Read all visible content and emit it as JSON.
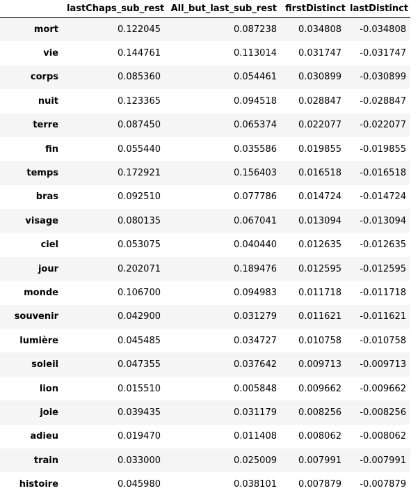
{
  "table": {
    "columns": [
      "",
      "lastChaps_sub_rest",
      "All_but_last_sub_rest",
      "firstDistinct",
      "lastDistinct"
    ],
    "rows": [
      {
        "index": "mort",
        "values": [
          "0.122045",
          "0.087238",
          "0.034808",
          "-0.034808"
        ]
      },
      {
        "index": "vie",
        "values": [
          "0.144761",
          "0.113014",
          "0.031747",
          "-0.031747"
        ]
      },
      {
        "index": "corps",
        "values": [
          "0.085360",
          "0.054461",
          "0.030899",
          "-0.030899"
        ]
      },
      {
        "index": "nuit",
        "values": [
          "0.123365",
          "0.094518",
          "0.028847",
          "-0.028847"
        ]
      },
      {
        "index": "terre",
        "values": [
          "0.087450",
          "0.065374",
          "0.022077",
          "-0.022077"
        ]
      },
      {
        "index": "fin",
        "values": [
          "0.055440",
          "0.035586",
          "0.019855",
          "-0.019855"
        ]
      },
      {
        "index": "temps",
        "values": [
          "0.172921",
          "0.156403",
          "0.016518",
          "-0.016518"
        ]
      },
      {
        "index": "bras",
        "values": [
          "0.092510",
          "0.077786",
          "0.014724",
          "-0.014724"
        ]
      },
      {
        "index": "visage",
        "values": [
          "0.080135",
          "0.067041",
          "0.013094",
          "-0.013094"
        ]
      },
      {
        "index": "ciel",
        "values": [
          "0.053075",
          "0.040440",
          "0.012635",
          "-0.012635"
        ]
      },
      {
        "index": "jour",
        "values": [
          "0.202071",
          "0.189476",
          "0.012595",
          "-0.012595"
        ]
      },
      {
        "index": "monde",
        "values": [
          "0.106700",
          "0.094983",
          "0.011718",
          "-0.011718"
        ]
      },
      {
        "index": "souvenir",
        "values": [
          "0.042900",
          "0.031279",
          "0.011621",
          "-0.011621"
        ]
      },
      {
        "index": "lumière",
        "values": [
          "0.045485",
          "0.034727",
          "0.010758",
          "-0.010758"
        ]
      },
      {
        "index": "soleil",
        "values": [
          "0.047355",
          "0.037642",
          "0.009713",
          "-0.009713"
        ]
      },
      {
        "index": "lion",
        "values": [
          "0.015510",
          "0.005848",
          "0.009662",
          "-0.009662"
        ]
      },
      {
        "index": "joie",
        "values": [
          "0.039435",
          "0.031179",
          "0.008256",
          "-0.008256"
        ]
      },
      {
        "index": "adieu",
        "values": [
          "0.019470",
          "0.011408",
          "0.008062",
          "-0.008062"
        ]
      },
      {
        "index": "train",
        "values": [
          "0.033000",
          "0.025009",
          "0.007991",
          "-0.007991"
        ]
      },
      {
        "index": "histoire",
        "values": [
          "0.045980",
          "0.038101",
          "0.007879",
          "-0.007879"
        ]
      }
    ]
  },
  "colors": {
    "stripe": "#f5f5f5",
    "header_rule": "#000000",
    "text": "#000000"
  }
}
